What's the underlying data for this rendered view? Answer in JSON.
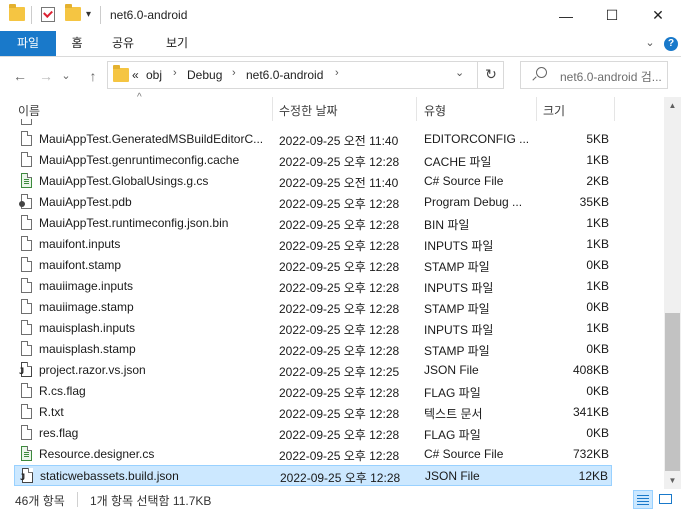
{
  "window": {
    "title": "net6.0-android",
    "minimize": "—",
    "maximize": "☐",
    "close": "✕"
  },
  "ribbon": {
    "tabs": [
      "파일",
      "홈",
      "공유",
      "보기"
    ],
    "expand": "⌄",
    "help": "?"
  },
  "nav": {
    "back": "←",
    "forward": "→",
    "recent": "⌄",
    "up": "↑",
    "overflow": "«",
    "breadcrumb": [
      "obj",
      "Debug",
      "net6.0-android"
    ],
    "sep": "›",
    "dropdown": "⌄",
    "refresh": "↻",
    "search_placeholder": "net6.0-android 검..."
  },
  "columns": {
    "name": "이름",
    "date": "수정한 날짜",
    "type": "유형",
    "size": "크기",
    "sort_indicator": "^"
  },
  "files": [
    {
      "name": "MauiAppTest.GeneratedMSBuildEditorC...",
      "date": "2022-09-25 오전 11:40",
      "type": "EDITORCONFIG ...",
      "size": "5KB",
      "icon": "file"
    },
    {
      "name": "MauiAppTest.genruntimeconfig.cache",
      "date": "2022-09-25 오후 12:28",
      "type": "CACHE 파일",
      "size": "1KB",
      "icon": "file"
    },
    {
      "name": "MauiAppTest.GlobalUsings.g.cs",
      "date": "2022-09-25 오전 11:40",
      "type": "C# Source File",
      "size": "2KB",
      "icon": "cs"
    },
    {
      "name": "MauiAppTest.pdb",
      "date": "2022-09-25 오후 12:28",
      "type": "Program Debug ...",
      "size": "35KB",
      "icon": "pdb"
    },
    {
      "name": "MauiAppTest.runtimeconfig.json.bin",
      "date": "2022-09-25 오후 12:28",
      "type": "BIN 파일",
      "size": "1KB",
      "icon": "file"
    },
    {
      "name": "mauifont.inputs",
      "date": "2022-09-25 오후 12:28",
      "type": "INPUTS 파일",
      "size": "1KB",
      "icon": "file"
    },
    {
      "name": "mauifont.stamp",
      "date": "2022-09-25 오후 12:28",
      "type": "STAMP 파일",
      "size": "0KB",
      "icon": "file"
    },
    {
      "name": "mauiimage.inputs",
      "date": "2022-09-25 오후 12:28",
      "type": "INPUTS 파일",
      "size": "1KB",
      "icon": "file"
    },
    {
      "name": "mauiimage.stamp",
      "date": "2022-09-25 오후 12:28",
      "type": "STAMP 파일",
      "size": "0KB",
      "icon": "file"
    },
    {
      "name": "mauisplash.inputs",
      "date": "2022-09-25 오후 12:28",
      "type": "INPUTS 파일",
      "size": "1KB",
      "icon": "file"
    },
    {
      "name": "mauisplash.stamp",
      "date": "2022-09-25 오후 12:28",
      "type": "STAMP 파일",
      "size": "0KB",
      "icon": "file"
    },
    {
      "name": "project.razor.vs.json",
      "date": "2022-09-25 오후 12:25",
      "type": "JSON File",
      "size": "408KB",
      "icon": "json"
    },
    {
      "name": "R.cs.flag",
      "date": "2022-09-25 오후 12:28",
      "type": "FLAG 파일",
      "size": "0KB",
      "icon": "file"
    },
    {
      "name": "R.txt",
      "date": "2022-09-25 오후 12:28",
      "type": "텍스트 문서",
      "size": "341KB",
      "icon": "file"
    },
    {
      "name": "res.flag",
      "date": "2022-09-25 오후 12:28",
      "type": "FLAG 파일",
      "size": "0KB",
      "icon": "file"
    },
    {
      "name": "Resource.designer.cs",
      "date": "2022-09-25 오후 12:28",
      "type": "C# Source File",
      "size": "732KB",
      "icon": "cs"
    },
    {
      "name": "staticwebassets.build.json",
      "date": "2022-09-25 오후 12:28",
      "type": "JSON File",
      "size": "12KB",
      "icon": "json",
      "selected": true
    }
  ],
  "status": {
    "count": "46개 항목",
    "selection": "1개 항목 선택함 11.7KB"
  },
  "colors": {
    "accent": "#1979ca",
    "selection_bg": "#cce8ff",
    "selection_border": "#99d1ff"
  }
}
